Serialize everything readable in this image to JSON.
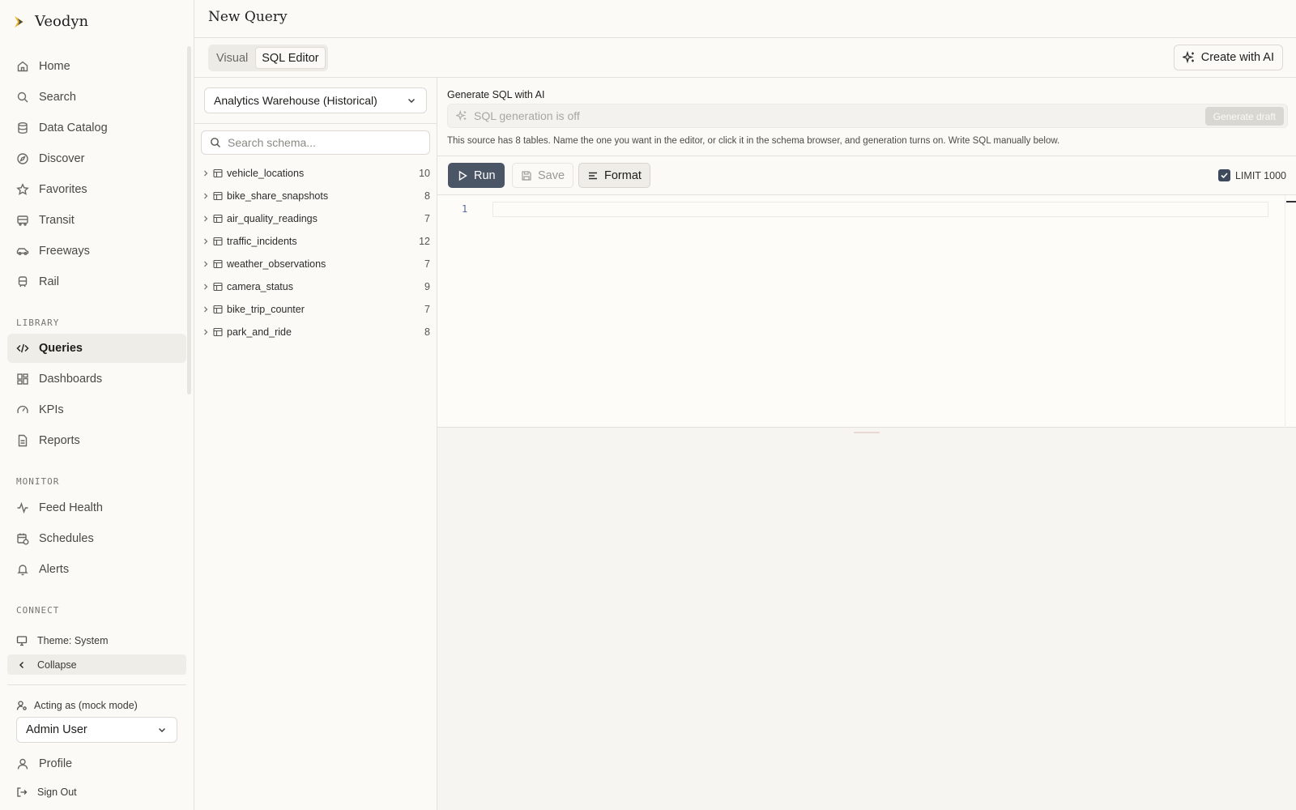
{
  "app": {
    "name": "Veodyn"
  },
  "sidebar": {
    "nav": [
      {
        "label": "Home",
        "icon": "home-icon"
      },
      {
        "label": "Search",
        "icon": "search-icon"
      },
      {
        "label": "Data Catalog",
        "icon": "database-icon"
      },
      {
        "label": "Discover",
        "icon": "compass-icon"
      },
      {
        "label": "Favorites",
        "icon": "star-icon"
      },
      {
        "label": "Transit",
        "icon": "bus-icon"
      },
      {
        "label": "Freeways",
        "icon": "car-icon"
      },
      {
        "label": "Rail",
        "icon": "train-icon"
      }
    ],
    "library_label": "LIBRARY",
    "library": [
      {
        "label": "Queries",
        "icon": "code-icon",
        "active": true
      },
      {
        "label": "Dashboards",
        "icon": "dashboard-icon"
      },
      {
        "label": "KPIs",
        "icon": "gauge-icon"
      },
      {
        "label": "Reports",
        "icon": "report-icon"
      }
    ],
    "monitor_label": "MONITOR",
    "monitor": [
      {
        "label": "Feed Health",
        "icon": "activity-icon"
      },
      {
        "label": "Schedules",
        "icon": "calendar-clock-icon"
      },
      {
        "label": "Alerts",
        "icon": "bell-icon"
      }
    ],
    "connect_label": "CONNECT",
    "theme_label": "Theme: System",
    "collapse_label": "Collapse",
    "acting_label": "Acting as (mock mode)",
    "user_select": "Admin User",
    "profile_label": "Profile",
    "signout_label": "Sign Out"
  },
  "header": {
    "title": "New Query"
  },
  "modes": {
    "visual": "Visual",
    "sql": "SQL Editor",
    "active": "SQL Editor"
  },
  "create_ai_label": "Create with AI",
  "schema": {
    "source": "Analytics Warehouse (Historical)",
    "search_placeholder": "Search schema...",
    "tables": [
      {
        "name": "vehicle_locations",
        "count": "10"
      },
      {
        "name": "bike_share_snapshots",
        "count": "8"
      },
      {
        "name": "air_quality_readings",
        "count": "7"
      },
      {
        "name": "traffic_incidents",
        "count": "12"
      },
      {
        "name": "weather_observations",
        "count": "7"
      },
      {
        "name": "camera_status",
        "count": "9"
      },
      {
        "name": "bike_trip_counter",
        "count": "7"
      },
      {
        "name": "park_and_ride",
        "count": "8"
      }
    ]
  },
  "generate": {
    "label": "Generate SQL with AI",
    "placeholder": "SQL generation is off",
    "button": "Generate draft",
    "note": "This source has 8 tables. Name the one you want in the editor, or click it in the schema browser, and generation turns on. Write SQL manually below."
  },
  "toolbar": {
    "run": "Run",
    "save": "Save",
    "format": "Format",
    "limit": "LIMIT 1000",
    "limit_checked": true
  },
  "editor": {
    "line_numbers": [
      "1"
    ]
  },
  "colors": {
    "accent": "#4a5566",
    "background": "#f6f5f1",
    "panel": "#fbfaf6",
    "brand_yellow": "#e8b422",
    "brand_dark": "#3c4657"
  }
}
